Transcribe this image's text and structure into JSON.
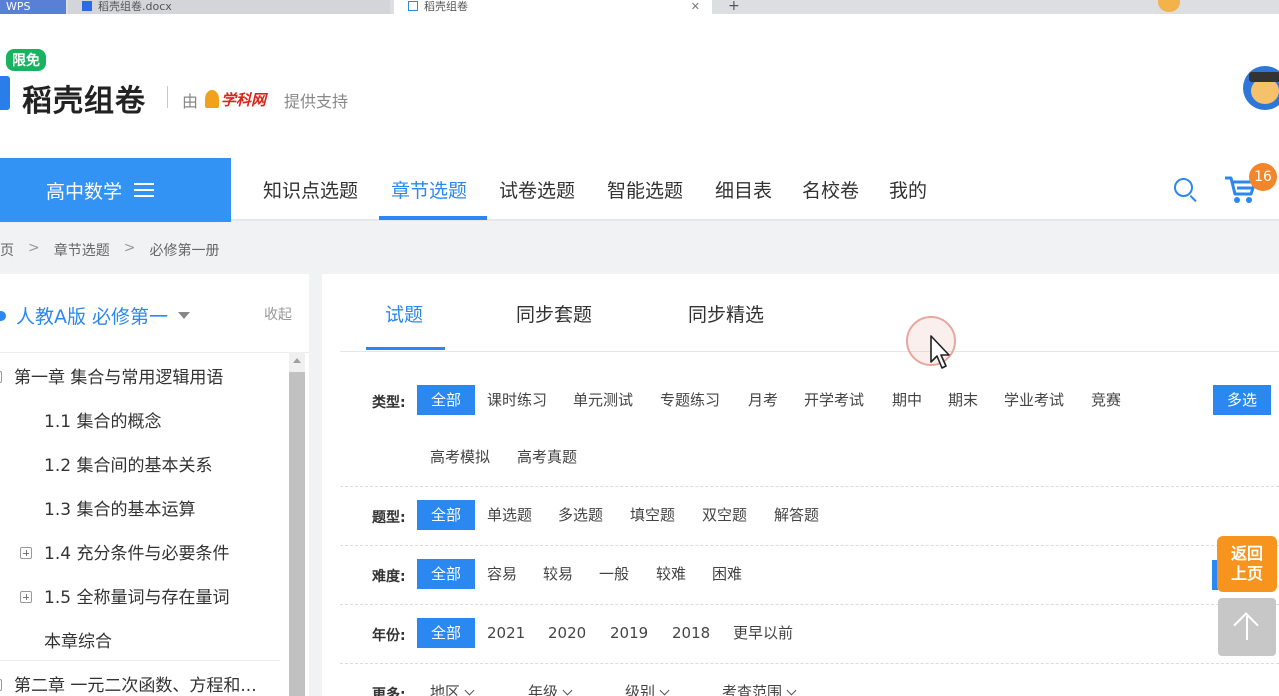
{
  "browser": {
    "tabs": [
      {
        "label": "WPS"
      },
      {
        "label": "稻壳组卷.docx"
      },
      {
        "label": "稻壳组卷"
      }
    ]
  },
  "header": {
    "badge": "限免",
    "logo_text": "稻壳组卷",
    "by_text": "由",
    "partner": "学科网",
    "support_text": "提供支持"
  },
  "nav": {
    "subject": "高中数学",
    "items": [
      "知识点选题",
      "章节选题",
      "试卷选题",
      "智能选题",
      "细目表",
      "名校卷",
      "我的"
    ],
    "active_index": 1,
    "cart_count": "16"
  },
  "breadcrumb": [
    "首页",
    "章节选题",
    "必修第一册"
  ],
  "sidebar": {
    "edition": "人教A版  必修第一",
    "collapse": "收起",
    "tree": [
      {
        "label": "第一章 集合与常用逻辑用语",
        "level": 0,
        "toggle": "minus"
      },
      {
        "label": "1.1 集合的概念",
        "level": 1,
        "toggle": "none"
      },
      {
        "label": "1.2 集合间的基本关系",
        "level": 1,
        "toggle": "none"
      },
      {
        "label": "1.3 集合的基本运算",
        "level": 1,
        "toggle": "none"
      },
      {
        "label": "1.4 充分条件与必要条件",
        "level": 1,
        "toggle": "plus"
      },
      {
        "label": "1.5 全称量词与存在量词",
        "level": 1,
        "toggle": "plus"
      },
      {
        "label": "本章综合",
        "level": 1,
        "toggle": "none"
      },
      {
        "label": "第二章 一元二次函数、方程和...",
        "level": 0,
        "toggle": "plus"
      }
    ]
  },
  "main": {
    "tabs": [
      "试题",
      "同步套题",
      "同步精选"
    ],
    "active_tab": 0,
    "filters": {
      "type": {
        "label": "类型:",
        "options": [
          "全部",
          "课时练习",
          "单元测试",
          "专题练习",
          "月考",
          "开学考试",
          "期中",
          "期末",
          "学业考试",
          "竞赛",
          "高考模拟",
          "高考真题"
        ],
        "multi": "多选"
      },
      "qtype": {
        "label": "题型:",
        "options": [
          "全部",
          "单选题",
          "多选题",
          "填空题",
          "双空题",
          "解答题"
        ]
      },
      "difficulty": {
        "label": "难度:",
        "options": [
          "全部",
          "容易",
          "较易",
          "一般",
          "较难",
          "困难"
        ]
      },
      "year": {
        "label": "年份:",
        "options": [
          "全部",
          "2021",
          "2020",
          "2019",
          "2018",
          "更早以前"
        ]
      },
      "more": {
        "label": "更多:",
        "options": [
          "地区",
          "年级",
          "级别",
          "考查范围"
        ]
      }
    }
  },
  "floating": {
    "back_line1": "返回",
    "back_line2": "上页"
  },
  "colors": {
    "primary": "#2b88f0",
    "subject_bg": "#3293f5",
    "badge_green": "#19b35f",
    "orange": "#f7941d"
  }
}
